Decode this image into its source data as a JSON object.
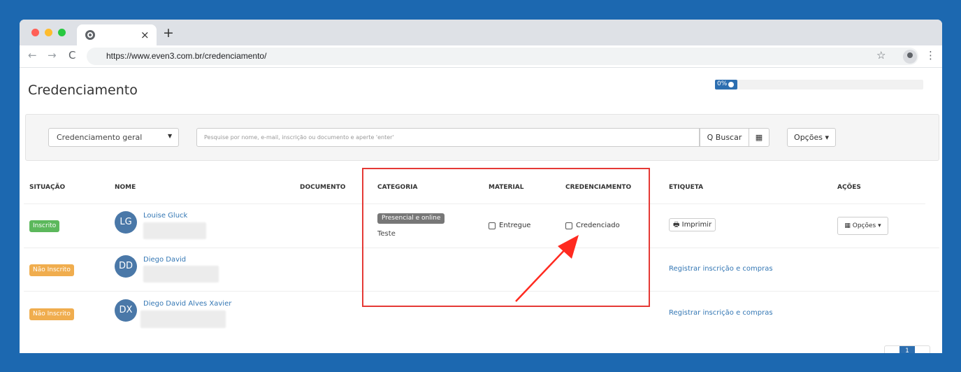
{
  "browser": {
    "url": "https://www.even3.com.br/credenciamento/",
    "tab_close": "×",
    "new_tab": "+",
    "back": "←",
    "forward": "→",
    "reload": "C",
    "star": "☆",
    "menu": "⋮"
  },
  "page": {
    "title": "Credenciamento",
    "progress": {
      "label": "0%",
      "value": 0
    }
  },
  "filters": {
    "select_value": "Credenciamento geral",
    "select_caret": "▼",
    "search_placeholder": "Pesquise por nome, e-mail, inscrição ou documento e aperte 'enter'",
    "search_button": "Q Buscar",
    "qr_button": "▦",
    "options_button": "Opções ▾"
  },
  "table": {
    "headers": [
      "SITUAÇÃO",
      "NOME",
      "DOCUMENTO",
      "CATEGORIA",
      "MATERIAL",
      "CREDENCIAMENTO",
      "ETIQUETA",
      "AÇÕES"
    ],
    "rows": [
      {
        "status": "Inscrito",
        "initials": "LG",
        "name": "Louise Gluck",
        "category": "Presencial e online",
        "category_sub": "Teste",
        "material": "Entregue",
        "accreditation": "Credenciado",
        "print": "🖶 Imprimir",
        "actions": "▦ Opções ▾"
      },
      {
        "status": "Não Inscrito",
        "initials": "DD",
        "name": "Diego David",
        "register_link": "Registrar inscrição e compras"
      },
      {
        "status": "Não Inscrito",
        "initials": "DX",
        "name": "Diego David Alves Xavier",
        "register_link": "Registrar inscrição e compras"
      }
    ]
  },
  "pagination": {
    "current": "1"
  },
  "colors": {
    "background": "#1c68b0",
    "badge_green": "#5cb85c",
    "badge_orange": "#f0ad4e",
    "link": "#3477b4",
    "highlight": "#e53935"
  }
}
